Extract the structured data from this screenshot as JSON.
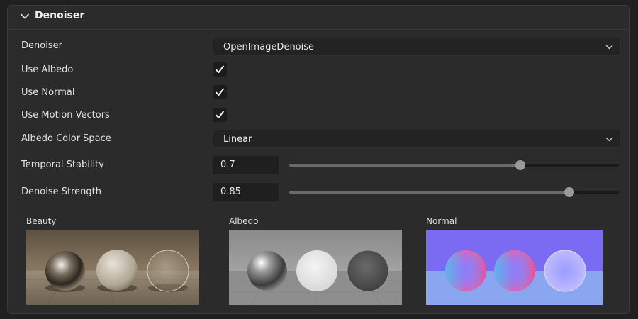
{
  "section": {
    "title": "Denoiser"
  },
  "rows": {
    "denoiser": {
      "label": "Denoiser",
      "value": "OpenImageDenoise"
    },
    "use_albedo": {
      "label": "Use Albedo",
      "checked": true
    },
    "use_normal": {
      "label": "Use Normal",
      "checked": true
    },
    "use_motion_vectors": {
      "label": "Use Motion Vectors",
      "checked": true
    },
    "albedo_color_space": {
      "label": "Albedo Color Space",
      "value": "Linear"
    },
    "temporal_stability": {
      "label": "Temporal Stability",
      "value": "0.7",
      "fraction": 0.7
    },
    "denoise_strength": {
      "label": "Denoise Strength",
      "value": "0.85",
      "fraction": 0.85
    }
  },
  "previews": [
    {
      "label": "Beauty"
    },
    {
      "label": "Albedo"
    },
    {
      "label": "Normal"
    }
  ],
  "colors": {
    "panel": "#2b2b2b",
    "background": "#202020",
    "normal_bg": "#7a6bf2"
  }
}
